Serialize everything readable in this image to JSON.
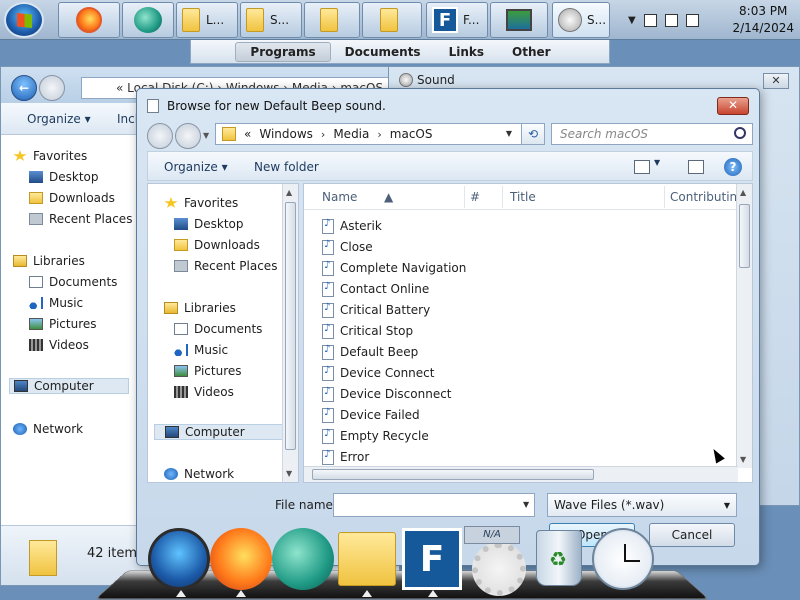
{
  "taskbar": {
    "buttons": [
      {
        "label": "L..."
      },
      {
        "label": "S..."
      },
      {
        "label": ""
      },
      {
        "label": ""
      },
      {
        "label": "F..."
      },
      {
        "label": ""
      },
      {
        "label": "S..."
      }
    ],
    "clock_time": "8:03 PM",
    "clock_date": "2/14/2024"
  },
  "jumplist": {
    "tabs": [
      "Programs",
      "Documents",
      "Links",
      "Other"
    ]
  },
  "explorer": {
    "address": "Local Disk (C:) › Windows › Media › macOS",
    "address_prefix": "«",
    "toolbar": {
      "organize": "Organize ▾",
      "include": "Incl"
    },
    "nav": {
      "favorites": "Favorites",
      "desktop": "Desktop",
      "downloads": "Downloads",
      "recent": "Recent Places",
      "libraries": "Libraries",
      "documents": "Documents",
      "music": "Music",
      "pictures": "Pictures",
      "videos": "Videos",
      "computer": "Computer",
      "network": "Network"
    },
    "status": "42 items"
  },
  "sound": {
    "title": "Sound",
    "close": "✕"
  },
  "dialog": {
    "title": "Browse for new Default Beep sound.",
    "close": "✕",
    "address": {
      "prefix": "«",
      "crumbs": [
        "Windows",
        "Media",
        "macOS"
      ],
      "sep": "›"
    },
    "search_placeholder": "Search macOS",
    "toolbar": {
      "organize": "Organize ▾",
      "new_folder": "New folder",
      "help": "?"
    },
    "nav": {
      "favorites": "Favorites",
      "desktop": "Desktop",
      "downloads": "Downloads",
      "recent": "Recent Places",
      "libraries": "Libraries",
      "documents": "Documents",
      "music": "Music",
      "pictures": "Pictures",
      "videos": "Videos",
      "computer": "Computer",
      "network": "Network"
    },
    "columns": {
      "name": "Name",
      "num": "#",
      "title": "Title",
      "contributing": "Contributing"
    },
    "files": [
      "Asterik",
      "Close",
      "Complete Navigation",
      "Contact Online",
      "Critical Battery",
      "Critical Stop",
      "Default Beep",
      "Device Connect",
      "Device Disconnect",
      "Device Failed",
      "Empty Recycle",
      "Error"
    ],
    "file_name_label": "File name:",
    "file_name_value": "",
    "file_type": "Wave Files (*.wav)",
    "open_label": "Open",
    "cancel_label": "Cancel"
  },
  "dock": {
    "na_label": "N/A"
  }
}
